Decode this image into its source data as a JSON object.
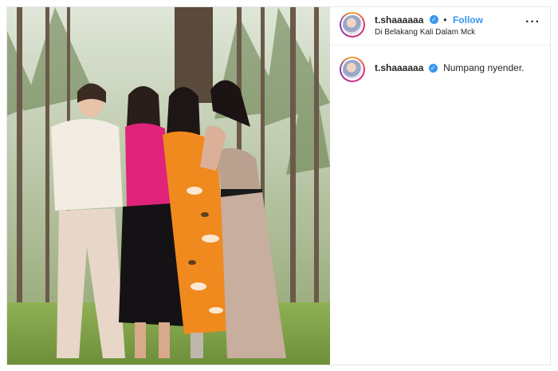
{
  "post": {
    "username": "t.shaaaaaa",
    "verified_icon": "verified-badge-icon",
    "separator": "•",
    "follow_label": "Follow",
    "location": "Di Belakang Kali Dalam Mck",
    "more_label": "···"
  },
  "comment": {
    "username": "t.shaaaaaa",
    "caption": "Numpang nyender."
  },
  "colors": {
    "accent": "#3897f0",
    "text": "#262626",
    "border": "#efefef"
  }
}
